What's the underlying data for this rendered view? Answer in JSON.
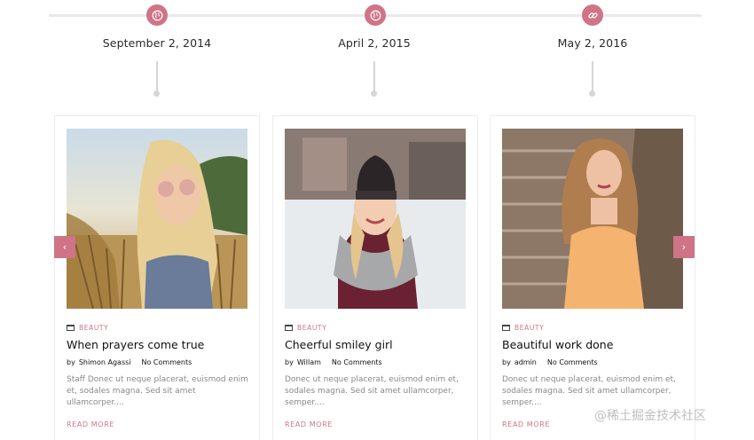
{
  "timeline": [
    {
      "date": "September 2, 2014",
      "icon": "globe-icon"
    },
    {
      "date": "April 2, 2015",
      "icon": "globe-icon"
    },
    {
      "date": "May 2, 2016",
      "icon": "link-icon"
    }
  ],
  "posts": [
    {
      "category": "BEAUTY",
      "title": "When prayers come true",
      "by": "by",
      "author": "Shimon Agassi",
      "comments": "No Comments",
      "excerpt": "Staff Donec ut neque placerat, euismod enim et, sodales magna. Sed sit amet ullamcorper....",
      "read_more": "READ MORE"
    },
    {
      "category": "BEAUTY",
      "title": "Cheerful smiley girl",
      "by": "by",
      "author": "Willam",
      "comments": "No Comments",
      "excerpt": "Donec ut neque placerat, euismod enim et, sodales magna. Sed sit amet ullamcorper, semper....",
      "read_more": "READ MORE"
    },
    {
      "category": "BEAUTY",
      "title": "Beautiful work done",
      "by": "by",
      "author": "admin",
      "comments": "No Comments",
      "excerpt": "Donec ut neque placerat, euismod enim et, sodales magna. Sed sit amet ullamcorper, semper....",
      "read_more": "READ MORE"
    }
  ],
  "carousel": {
    "prev": "‹",
    "next": "›"
  },
  "watermark": "@稀土掘金技术社区",
  "colors": {
    "accent": "#cf7487",
    "line": "#e9e9ec",
    "muted": "#888888"
  }
}
